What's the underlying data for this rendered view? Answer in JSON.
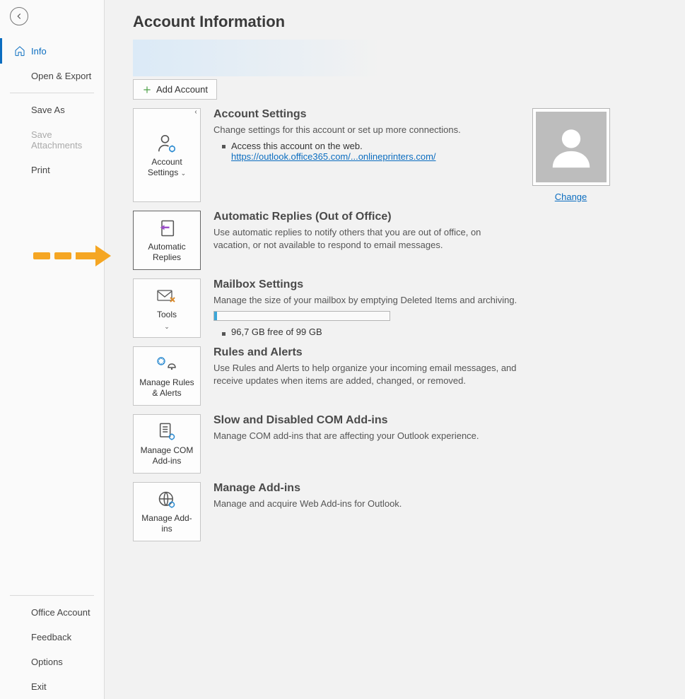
{
  "sidebar": {
    "items": {
      "info": "Info",
      "open_export": "Open & Export",
      "save_as": "Save As",
      "save_attachments": "Save Attachments",
      "print": "Print",
      "office_account": "Office Account",
      "feedback": "Feedback",
      "options": "Options",
      "exit": "Exit"
    }
  },
  "header": {
    "title": "Account Information",
    "add_account": "Add Account"
  },
  "account_settings": {
    "tile_label": "Account Settings",
    "heading": "Account Settings",
    "desc": "Change settings for this account or set up more connections.",
    "bullet": "Access this account on the web.",
    "url": "https://outlook.office365.com/...onlineprinters.com/",
    "change": "Change"
  },
  "auto_replies": {
    "tile_label": "Automatic Replies",
    "heading": "Automatic Replies (Out of Office)",
    "desc": "Use automatic replies to notify others that you are out of office, on vacation, or not available to respond to email messages."
  },
  "mailbox": {
    "tile_label": "Tools",
    "heading": "Mailbox Settings",
    "desc": "Manage the size of your mailbox by emptying Deleted Items and archiving.",
    "storage": "96,7 GB free of 99 GB"
  },
  "rules": {
    "tile_label": "Manage Rules & Alerts",
    "heading": "Rules and Alerts",
    "desc": "Use Rules and Alerts to help organize your incoming email messages, and receive updates when items are added, changed, or removed."
  },
  "com_addins": {
    "tile_label": "Manage COM Add-ins",
    "heading": "Slow and Disabled COM Add-ins",
    "desc": "Manage COM add-ins that are affecting your Outlook experience."
  },
  "web_addins": {
    "tile_label": "Manage Add-ins",
    "heading": "Manage Add-ins",
    "desc": "Manage and acquire Web Add-ins for Outlook."
  }
}
